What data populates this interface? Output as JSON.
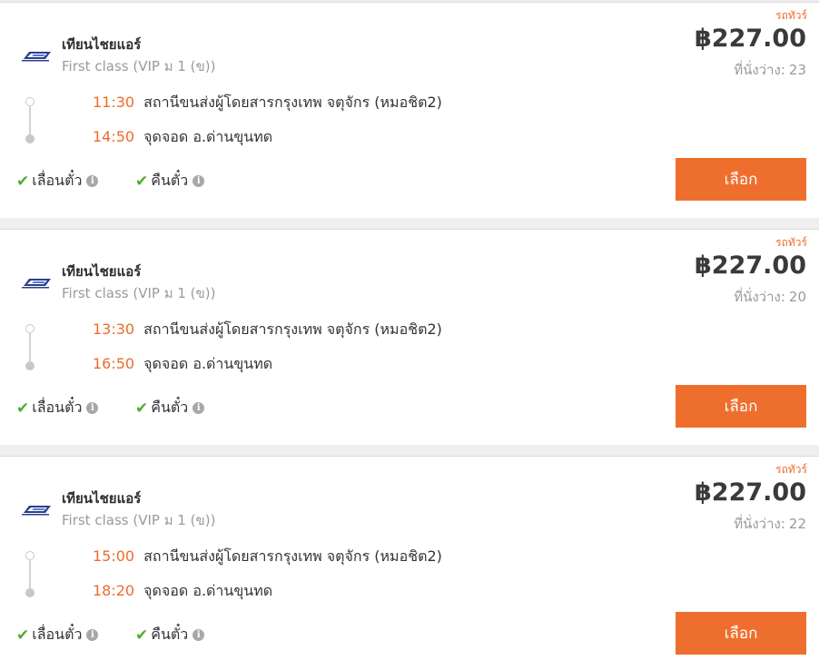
{
  "currency_symbol": "฿",
  "accent_color": "#ee6b2a",
  "check_color": "#4caf2e",
  "trips": [
    {
      "bus_type": "รถทัวร์",
      "operator": "เทียนไชยแอร์",
      "service_class": "First class (VIP ม 1 (ข))",
      "price": "฿227.00",
      "seats_label": "ที่นั่งว่าง:",
      "seats_count": "23",
      "departure_time": "11:30",
      "departure_place": "สถานีขนส่งผู้โดยสารกรุงเทพ จตุจักร (หมอชิต2)",
      "arrival_time": "14:50",
      "arrival_place": "จุดจอด อ.ด่านขุนทด",
      "feature_reschedule": "เลื่อนตั๋ว",
      "feature_refund": "คืนตั๋ว",
      "select_label": "เลือก"
    },
    {
      "bus_type": "รถทัวร์",
      "operator": "เทียนไชยแอร์",
      "service_class": "First class (VIP ม 1 (ข))",
      "price": "฿227.00",
      "seats_label": "ที่นั่งว่าง:",
      "seats_count": "20",
      "departure_time": "13:30",
      "departure_place": "สถานีขนส่งผู้โดยสารกรุงเทพ จตุจักร (หมอชิต2)",
      "arrival_time": "16:50",
      "arrival_place": "จุดจอด อ.ด่านขุนทด",
      "feature_reschedule": "เลื่อนตั๋ว",
      "feature_refund": "คืนตั๋ว",
      "select_label": "เลือก"
    },
    {
      "bus_type": "รถทัวร์",
      "operator": "เทียนไชยแอร์",
      "service_class": "First class (VIP ม 1 (ข))",
      "price": "฿227.00",
      "seats_label": "ที่นั่งว่าง:",
      "seats_count": "22",
      "departure_time": "15:00",
      "departure_place": "สถานีขนส่งผู้โดยสารกรุงเทพ จตุจักร (หมอชิต2)",
      "arrival_time": "18:20",
      "arrival_place": "จุดจอด อ.ด่านขุนทด",
      "feature_reschedule": "เลื่อนตั๋ว",
      "feature_refund": "คืนตั๋ว",
      "select_label": "เลือก"
    }
  ]
}
